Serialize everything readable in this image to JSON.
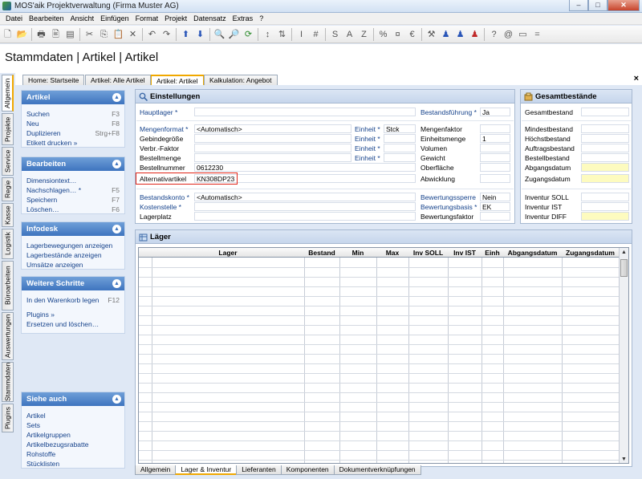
{
  "window": {
    "title": "MOS'aik Projektverwaltung (Firma Muster AG)",
    "min": "–",
    "max": "□",
    "close": "✕"
  },
  "menu": [
    "Datei",
    "Bearbeiten",
    "Ansicht",
    "Einfügen",
    "Format",
    "Projekt",
    "Datensatz",
    "Extras",
    "?"
  ],
  "toolbar_icons": [
    "new-icon",
    "open-icon",
    "print-icon",
    "print-preview-icon",
    "page-setup-icon",
    "cut-icon",
    "copy-icon",
    "paste-icon",
    "delete-icon",
    "undo-icon",
    "redo-icon",
    "up-icon",
    "down-icon",
    "search-icon",
    "find-icon",
    "refresh-icon",
    "sort-icon",
    "sort-desc-icon",
    "text-icon",
    "number-icon",
    "s-icon",
    "a-icon",
    "z-icon",
    "percent-icon",
    "currency-icon",
    "euro-icon",
    "tools-icon",
    "user-blue-icon",
    "user-blue2-icon",
    "user-red-icon",
    "question-icon",
    "at-icon",
    "field-icon",
    "equals-icon"
  ],
  "toolbar_glyphs": [
    "🗋",
    "📂",
    "🖶",
    "🖹",
    "▤",
    "✂",
    "⎘",
    "📋",
    "✕",
    "↶",
    "↷",
    "⬆",
    "⬇",
    "🔍",
    "🔎",
    "⟳",
    "↕",
    "⇅",
    "I",
    "#",
    "S",
    "A",
    "Z",
    "%",
    "¤",
    "€",
    "⚒",
    "♟",
    "♟",
    "♟",
    "?",
    "@",
    "▭",
    "="
  ],
  "page_title": "Stammdaten | Artikel | Artikel",
  "doc_tabs": [
    "Home: Startseite",
    "Artikel: Alle Artikel",
    "Artikel: Artikel",
    "Kalkulation: Angebot"
  ],
  "doc_tab_close": "×",
  "vertical_tabs": [
    "Allgemein",
    "Projekte",
    "Service",
    "Regie",
    "Kasse",
    "Logistik",
    "Büroarbeiten",
    "Auswertungen",
    "Stammdaten",
    "Plugins"
  ],
  "sidebar": {
    "artikel": {
      "title": "Artikel",
      "items": [
        {
          "label": "Suchen",
          "key": "F3"
        },
        {
          "label": "Neu",
          "key": "F8"
        },
        {
          "label": "Duplizieren",
          "key": "Strg+F8"
        },
        {
          "label": "Etikett drucken »",
          "key": ""
        }
      ]
    },
    "bearbeiten": {
      "title": "Bearbeiten",
      "items": [
        {
          "label": "Dimensiontext…",
          "key": ""
        },
        {
          "label": "Nachschlagen… *",
          "key": "F5"
        },
        {
          "label": "Speichern",
          "key": "F7"
        },
        {
          "label": "Löschen…",
          "key": "F6"
        }
      ]
    },
    "infodesk": {
      "title": "Infodesk",
      "items": [
        {
          "label": "Lagerbewegungen anzeigen",
          "key": ""
        },
        {
          "label": "Lagerbestände anzeigen",
          "key": ""
        },
        {
          "label": "Umsätze anzeigen",
          "key": ""
        }
      ]
    },
    "weitere": {
      "title": "Weitere Schritte",
      "items": [
        {
          "label": "In den Warenkorb legen",
          "key": "F12"
        },
        {
          "label": "Plugins »",
          "key": ""
        },
        {
          "label": "Ersetzen und löschen…",
          "key": ""
        }
      ]
    },
    "siehe": {
      "title": "Siehe auch",
      "items": [
        "Artikel",
        "Sets",
        "Artikelgruppen",
        "Artikelbezugsrabatte",
        "Rohstoffe",
        "Stücklisten"
      ]
    },
    "chevron": "▲"
  },
  "einstellungen": {
    "title": "Einstellungen",
    "hauptlager": "Hauptlager *",
    "bestandsfuehrung": {
      "label": "Bestandsführung *",
      "value": "Ja"
    },
    "mengenformat": {
      "label": "Mengenformat *",
      "value": "<Automatisch>"
    },
    "gebindegroesse": "Gebindegröße",
    "verbr_faktor": "Verbr.-Faktor",
    "bestellmenge": "Bestellmenge",
    "bestellnummer": {
      "label": "Bestellnummer",
      "value": "0612230"
    },
    "alternativartikel": {
      "label": "Alternativartikel",
      "value": "KN308DP23"
    },
    "einheit1": {
      "label": "Einheit *",
      "value": "Stck"
    },
    "einheit2": "Einheit *",
    "einheit3": "Einheit *",
    "einheit4": "Einheit *",
    "mengenfaktor": "Mengenfaktor",
    "einheitsmenge": {
      "label": "Einheitsmenge",
      "value": "1"
    },
    "volumen": "Volumen",
    "gewicht": "Gewicht",
    "oberflaeche": "Oberfläche",
    "abwicklung": "Abwicklung",
    "bestandskonto": {
      "label": "Bestandskonto *",
      "value": "<Automatisch>"
    },
    "kostenstelle": "Kostenstelle *",
    "lagerplatz": "Lagerplatz",
    "bewertungssperre": {
      "label": "Bewertungssperre",
      "value": "Nein"
    },
    "bewertungsbasis": {
      "label": "Bewertungsbasis *",
      "value": "EK"
    },
    "bewertungsfaktor": "Bewertungsfaktor"
  },
  "gesamtbestaende": {
    "title": "Gesamtbestände",
    "rows": [
      "Gesamtbestand",
      "Mindestbestand",
      "Höchstbestand",
      "Auftragsbestand",
      "Bestellbestand",
      "Abgangsdatum",
      "Zugangsdatum",
      "Inventur SOLL",
      "Inventur IST",
      "Inventur DIFF"
    ]
  },
  "lager": {
    "title": "Läger",
    "columns": [
      "Lager",
      "Bestand",
      "Min",
      "Max",
      "Inv SOLL",
      "Inv IST",
      "Einh",
      "Abgangsdatum",
      "Zugangsdatum"
    ]
  },
  "bottom_tabs": [
    "Allgemein",
    "Lager & Inventur",
    "Lieferanten",
    "Komponenten",
    "Dokumentverknüpfungen"
  ],
  "colors": {
    "header_blue": "#3e74bf",
    "accent_orange": "#f0a800",
    "highlight_red": "#e0261a",
    "yellow_field": "#fdfbbf"
  }
}
